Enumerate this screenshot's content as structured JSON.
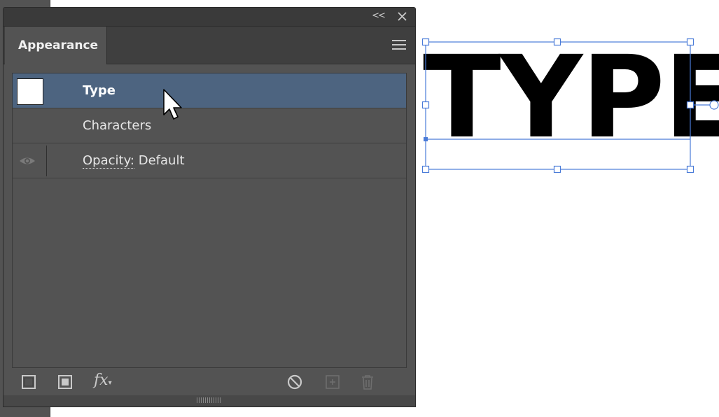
{
  "panel": {
    "tab_label": "Appearance",
    "collapse_label": "<<",
    "rows": [
      {
        "label": "Type",
        "selected": true
      },
      {
        "label": "Characters"
      },
      {
        "label_key": "Opacity:",
        "label_value": "Default"
      }
    ],
    "footer_icons": [
      "add-new-stroke-icon",
      "add-new-fill-icon",
      "fx-icon",
      "clear-appearance-icon",
      "duplicate-item-icon",
      "delete-item-icon"
    ],
    "fx_label": "fx"
  },
  "canvas": {
    "text": "TYPE"
  },
  "colors": {
    "panel_bg": "#535353",
    "selected_row": "#4d6480",
    "selection_blue": "#4a7bd8"
  }
}
